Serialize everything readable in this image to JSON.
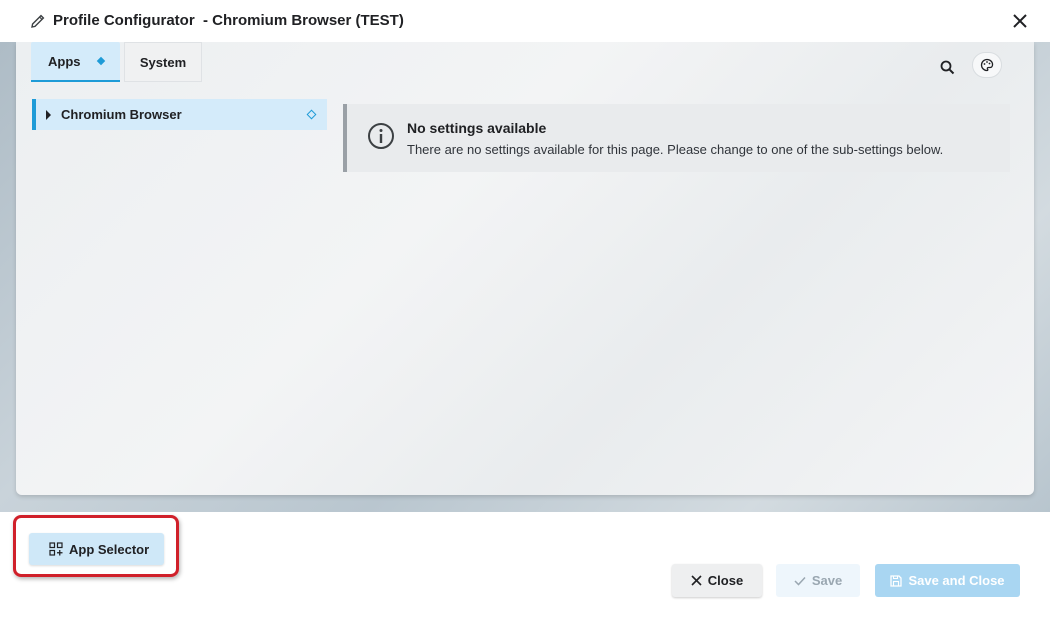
{
  "dialog": {
    "title": "Profile Configurator  - Chromium Browser (TEST)",
    "title_icon": "pencil-icon",
    "close_icon": "close-icon"
  },
  "tabs": [
    {
      "label": "Apps",
      "active": true,
      "modified_marker": "diamond-icon"
    },
    {
      "label": "System",
      "active": false
    }
  ],
  "toolbar": {
    "search_icon": "search-icon",
    "theme_icon": "palette-icon"
  },
  "tree": {
    "items": [
      {
        "label": "Chromium Browser",
        "expanded": false,
        "marker": "diamond-outline-icon"
      }
    ]
  },
  "notice": {
    "icon": "info-icon",
    "title": "No settings available",
    "text": "There are no settings available for this page. Please change to one of the sub-settings below."
  },
  "footer": {
    "app_selector_label": "App Selector",
    "close_label": "Close",
    "save_label": "Save",
    "save_close_label": "Save and Close"
  },
  "colors": {
    "accent": "#1e9bd7",
    "tab_active_bg": "#d4ebfa",
    "highlight": "#d0202a",
    "primary_disabled": "#a9d6f2"
  }
}
